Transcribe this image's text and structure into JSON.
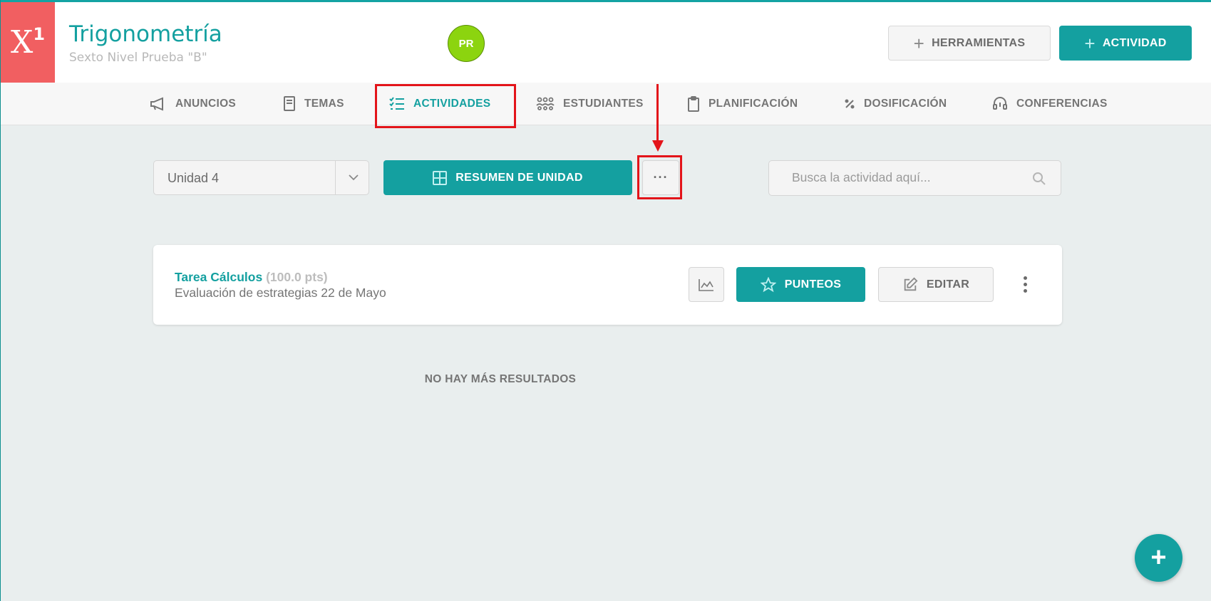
{
  "header": {
    "logo_text": "X",
    "logo_sup": "1",
    "course_title": "Trigonometría",
    "course_subtitle": "Sexto Nivel Prueba \"B\"",
    "avatar_initials": "PR",
    "tools_button": "HERRAMIENTAS",
    "activity_button": "ACTIVIDAD"
  },
  "nav": {
    "items": [
      {
        "label": "ANUNCIOS",
        "icon": "megaphone-icon"
      },
      {
        "label": "TEMAS",
        "icon": "book-icon"
      },
      {
        "label": "ACTIVIDADES",
        "icon": "checklist-icon",
        "active": true
      },
      {
        "label": "ESTUDIANTES",
        "icon": "students-icon"
      },
      {
        "label": "PLANIFICACIÓN",
        "icon": "clipboard-icon"
      },
      {
        "label": "DOSIFICACIÓN",
        "icon": "percent-icon"
      },
      {
        "label": "CONFERENCIAS",
        "icon": "headset-icon"
      }
    ]
  },
  "toolbar": {
    "unit_value": "Unidad 4",
    "summary_button": "RESUMEN DE UNIDAD",
    "more_button": "···",
    "search_placeholder": "Busca la actividad aquí..."
  },
  "activities": [
    {
      "title": "Tarea Cálculos",
      "points": "(100.0 pts)",
      "description": "Evaluación de estrategias 22 de Mayo",
      "punteos_button": "PUNTEOS",
      "editar_button": "EDITAR"
    }
  ],
  "no_more_results": "NO HAY MÁS RESULTADOS",
  "fab_label": "+",
  "colors": {
    "accent": "#14a0a0",
    "logo": "#f15f61",
    "avatar": "#8cd40f",
    "annotation": "#e3141a"
  }
}
